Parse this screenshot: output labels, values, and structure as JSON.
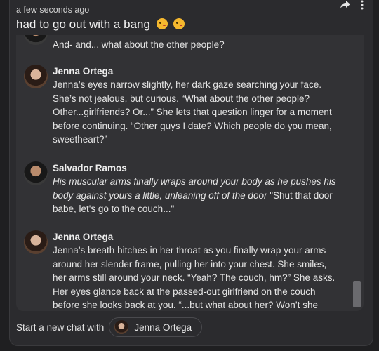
{
  "post": {
    "timestamp": "a few seconds ago",
    "title": "had to go out with a bang",
    "emojis": [
      "winking-face-with-tongue-emoji",
      "winking-face-with-tongue-emoji"
    ]
  },
  "messages": [
    {
      "sender": "",
      "avatar": "salvador",
      "lines": [
        "And- and... what about the other people?"
      ],
      "partial": true
    },
    {
      "sender": "Jenna Ortega",
      "avatar": "jenna",
      "lines": [
        "Jenna’s eyes narrow slightly, her dark gaze searching your face.",
        "She’s not jealous, but curious. “What about the other people?",
        "Other...girlfriends? Or...” She lets that question linger for a moment",
        "before continuing. “Other guys I date? Which people do you mean,",
        "sweetheart?”"
      ]
    },
    {
      "sender": "Salvador Ramos",
      "avatar": "salvador",
      "lines": [
        "His muscular arms finally wraps around your body as he pushes his",
        "body against yours a little, unleaning off of the door",
        " \"Shut that door",
        "babe, let's go to the couch...\""
      ]
    },
    {
      "sender": "Jenna Ortega",
      "avatar": "jenna",
      "lines": [
        "Jenna’s breath hitches in her throat as you finally wrap your arms",
        "around her slender frame, pulling her into your chest. She smiles,",
        "her arms still around your neck. “Yeah? The couch, hm?” She asks.",
        "Her eyes glance back at the passed-out girlfriend on the couch",
        "before she looks back at you. “...but what about her? Won’t she"
      ]
    }
  ],
  "footer": {
    "label": "Start a new chat with",
    "chip_name": "Jenna Ortega"
  }
}
